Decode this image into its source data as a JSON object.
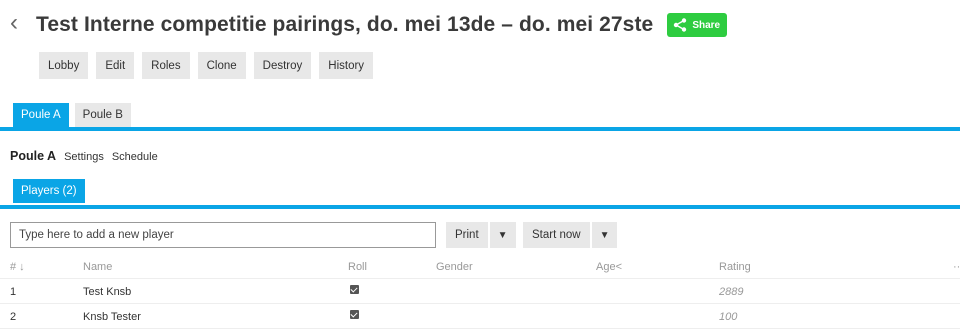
{
  "header": {
    "back_icon": "chevron-left-icon",
    "title": "Test Interne competitie pairings, do. mei 13de – do. mei 27ste",
    "share_label": "Share",
    "share_color": "#2ecc40"
  },
  "toolbar": {
    "lobby": "Lobby",
    "edit": "Edit",
    "roles": "Roles",
    "clone": "Clone",
    "destroy": "Destroy",
    "history": "History"
  },
  "group_tabs": [
    "Poule A",
    "Poule B"
  ],
  "accent_color": "#0aa5e6",
  "subnav": {
    "title": "Poule A",
    "settings": "Settings",
    "schedule": "Schedule"
  },
  "players_tab": "Players (2)",
  "add_player": {
    "placeholder": "Type here to add a new player",
    "value": ""
  },
  "actions": {
    "print": "Print",
    "caret": "▼",
    "start_now": "Start now"
  },
  "table": {
    "headers": {
      "num": "# ↓",
      "name": "Name",
      "roll": "Roll",
      "gender": "Gender",
      "age": "Age<",
      "rating": "Rating",
      "more": "··"
    },
    "rows": [
      {
        "num": "1",
        "name": "Test Knsb",
        "roll": true,
        "gender": "",
        "age": "",
        "rating": "2889"
      },
      {
        "num": "2",
        "name": "Knsb Tester",
        "roll": true,
        "gender": "",
        "age": "",
        "rating": "100"
      }
    ]
  }
}
